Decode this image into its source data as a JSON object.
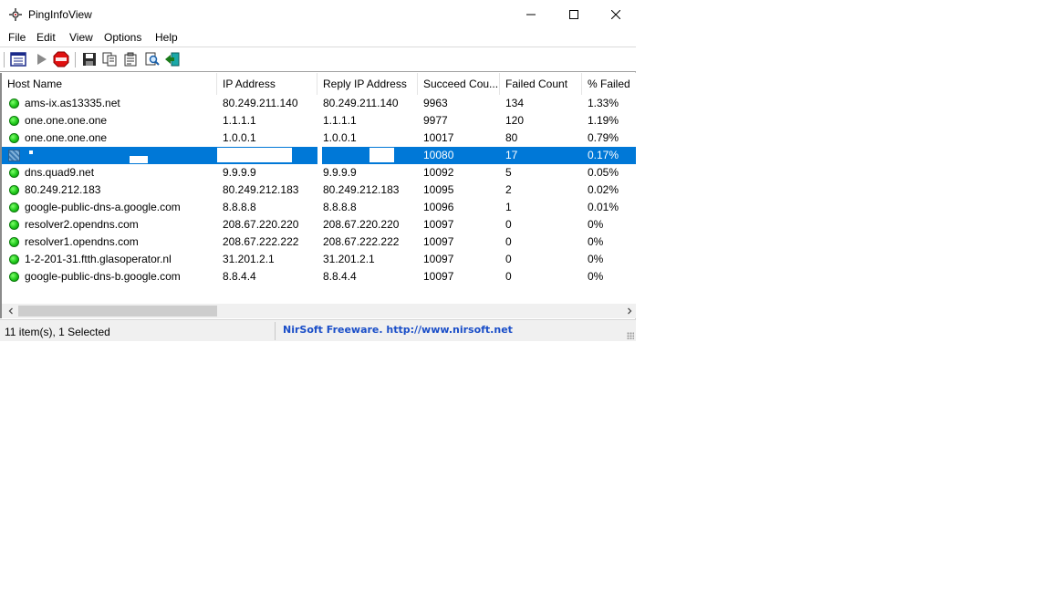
{
  "window": {
    "title": "PingInfoView"
  },
  "menu": {
    "items": [
      "File",
      "Edit",
      "View",
      "Options",
      "Help"
    ]
  },
  "toolbar": {
    "buttons": [
      "properties-icon",
      "start-ping-icon",
      "stop-icon",
      "save-icon",
      "copy-icon",
      "html-report-icon",
      "find-icon",
      "exit-icon"
    ]
  },
  "table": {
    "columns": [
      "Host Name",
      "IP Address",
      "Reply IP Address",
      "Succeed Cou...",
      "Failed Count",
      "% Failed"
    ],
    "rows": [
      {
        "host": "ams-ix.as13335.net",
        "ip": "80.249.211.140",
        "reply_ip": "80.249.211.140",
        "succeed": "9963",
        "failed": "134",
        "pct": "1.33%"
      },
      {
        "host": "one.one.one.one",
        "ip": "1.1.1.1",
        "reply_ip": "1.1.1.1",
        "succeed": "9977",
        "failed": "120",
        "pct": "1.19%"
      },
      {
        "host": "one.one.one.one",
        "ip": "1.0.0.1",
        "reply_ip": "1.0.0.1",
        "succeed": "10017",
        "failed": "80",
        "pct": "0.79%"
      },
      {
        "host": "",
        "ip": "",
        "reply_ip": "",
        "succeed": "10080",
        "failed": "17",
        "pct": "0.17%",
        "selected": true
      },
      {
        "host": "dns.quad9.net",
        "ip": "9.9.9.9",
        "reply_ip": "9.9.9.9",
        "succeed": "10092",
        "failed": "5",
        "pct": "0.05%"
      },
      {
        "host": "80.249.212.183",
        "ip": "80.249.212.183",
        "reply_ip": "80.249.212.183",
        "succeed": "10095",
        "failed": "2",
        "pct": "0.02%"
      },
      {
        "host": "google-public-dns-a.google.com",
        "ip": "8.8.8.8",
        "reply_ip": "8.8.8.8",
        "succeed": "10096",
        "failed": "1",
        "pct": "0.01%"
      },
      {
        "host": "resolver2.opendns.com",
        "ip": "208.67.220.220",
        "reply_ip": "208.67.220.220",
        "succeed": "10097",
        "failed": "0",
        "pct": "0%"
      },
      {
        "host": "resolver1.opendns.com",
        "ip": "208.67.222.222",
        "reply_ip": "208.67.222.222",
        "succeed": "10097",
        "failed": "0",
        "pct": "0%"
      },
      {
        "host": "1-2-201-31.ftth.glasoperator.nl",
        "ip": "31.201.2.1",
        "reply_ip": "31.201.2.1",
        "succeed": "10097",
        "failed": "0",
        "pct": "0%"
      },
      {
        "host": "google-public-dns-b.google.com",
        "ip": "8.8.4.4",
        "reply_ip": "8.8.4.4",
        "succeed": "10097",
        "failed": "0",
        "pct": "0%"
      }
    ]
  },
  "status": {
    "items_text": "11 item(s), 1 Selected",
    "credit": "NirSoft Freeware.  http://www.nirsoft.net"
  },
  "colors": {
    "selection": "#0078d7",
    "credit": "#1a4ec8",
    "status_ok": "#1ec81a"
  }
}
